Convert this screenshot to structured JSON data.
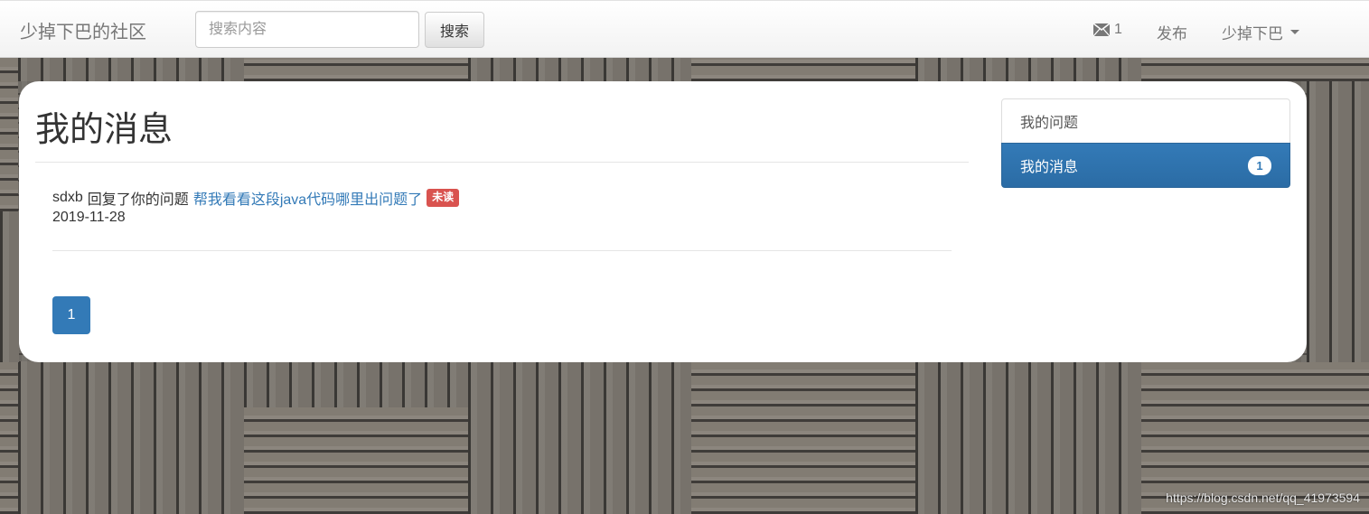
{
  "navbar": {
    "brand": "少掉下巴的社区",
    "search_placeholder": "搜索内容",
    "search_button": "搜索",
    "message_count": "1",
    "publish": "发布",
    "user": "少掉下巴"
  },
  "main": {
    "title": "我的消息",
    "messages": [
      {
        "from": "sdxb",
        "action": "回复了你的问题",
        "question": "帮我看看这段java代码哪里出问题了",
        "status": "未读",
        "date": "2019-11-28"
      }
    ],
    "pagination": [
      "1"
    ]
  },
  "sidebar": {
    "items": [
      {
        "label": "我的问题"
      },
      {
        "label": "我的消息",
        "badge": "1",
        "active": true
      }
    ]
  },
  "watermark": "https://blog.csdn.net/qq_41973594",
  "colors": {
    "primary": "#337ab7",
    "danger": "#d9534f"
  }
}
